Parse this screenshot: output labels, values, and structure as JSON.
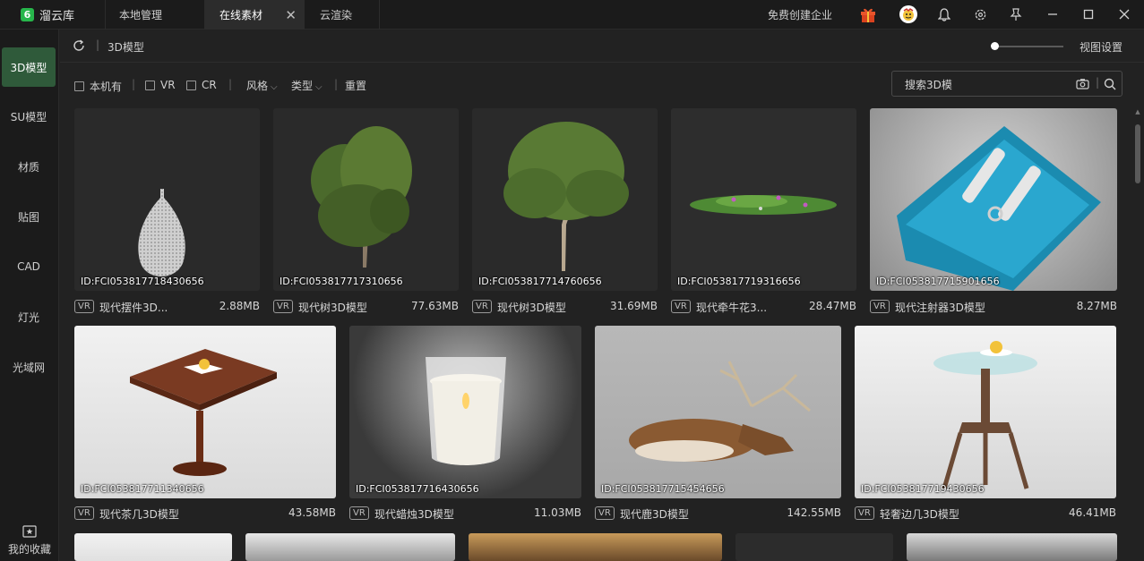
{
  "app": {
    "name": "溜云库",
    "logo_glyph": "6"
  },
  "tabs": [
    {
      "label": "本地管理",
      "active": false
    },
    {
      "label": "在线素材",
      "active": true
    },
    {
      "label": "云渲染",
      "active": false
    }
  ],
  "titlebar": {
    "enterprise_link": "免费创建企业",
    "icons": [
      "gift-icon",
      "avatar",
      "bell-icon",
      "gear-icon",
      "pin-icon",
      "minimize-icon",
      "maximize-icon",
      "close-icon"
    ]
  },
  "nav": {
    "items": [
      {
        "label": "3D模型",
        "active": true
      },
      {
        "label": "SU模型",
        "active": false
      },
      {
        "label": "材质",
        "active": false
      },
      {
        "label": "贴图",
        "active": false
      },
      {
        "label": "CAD",
        "active": false
      },
      {
        "label": "灯光",
        "active": false
      },
      {
        "label": "光域网",
        "active": false
      }
    ],
    "favorites": "我的收藏"
  },
  "pathbar": {
    "breadcrumb": "3D模型",
    "view_settings": "视图设置",
    "thumb_size": 0.05
  },
  "filters": {
    "local": "本机有",
    "vr": "VR",
    "cr": "CR",
    "style": "风格",
    "type": "类型",
    "reset": "重置",
    "search_value": "搜索3D模"
  },
  "colors": {
    "accent_green": "#27b64b",
    "active_nav": "#2f5a3a",
    "bg": "#222222"
  },
  "items": [
    {
      "id": "ID:FCI053817718430656",
      "badge": "VR",
      "title": "现代摆件3D...",
      "size": "2.88MB"
    },
    {
      "id": "ID:FCI053817717310656",
      "badge": "VR",
      "title": "现代树3D模型",
      "size": "77.63MB"
    },
    {
      "id": "ID:FCI053817714760656",
      "badge": "VR",
      "title": "现代树3D模型",
      "size": "31.69MB"
    },
    {
      "id": "ID:FCI053817719316656",
      "badge": "VR",
      "title": "现代牵牛花3...",
      "size": "28.47MB"
    },
    {
      "id": "ID:FCI053817715901656",
      "badge": "VR",
      "title": "现代注射器3D模型",
      "size": "8.27MB"
    },
    {
      "id": "ID:FCI053817711340656",
      "badge": "VR",
      "title": "现代茶几3D模型",
      "size": "43.58MB"
    },
    {
      "id": "ID:FCI053817716430656",
      "badge": "VR",
      "title": "现代蜡烛3D模型",
      "size": "11.03MB"
    },
    {
      "id": "ID:FCI053817715454656",
      "badge": "VR",
      "title": "现代鹿3D模型",
      "size": "142.55MB"
    },
    {
      "id": "ID:FCI053817719430656",
      "badge": "VR",
      "title": "轻奢边几3D模型",
      "size": "46.41MB"
    }
  ]
}
